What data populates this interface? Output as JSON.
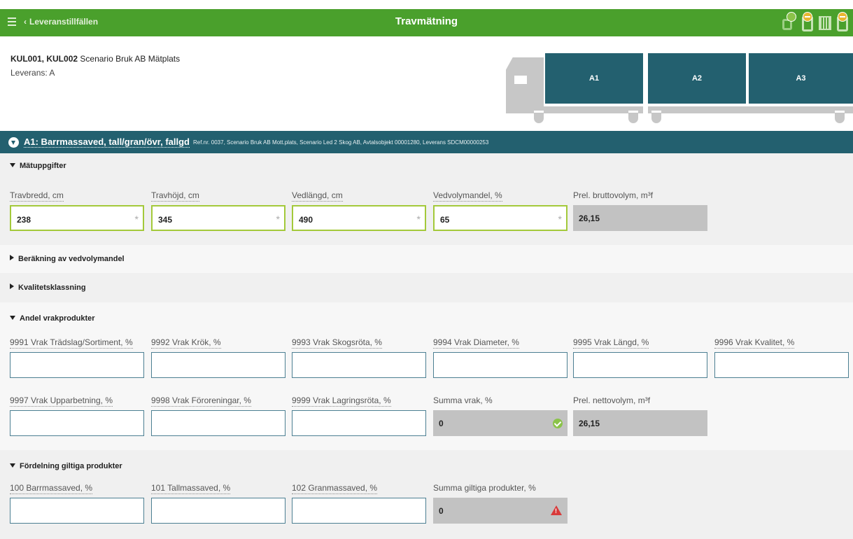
{
  "header": {
    "back_label": "Leveranstillfällen",
    "title": "Travmätning",
    "accent": "#4aa02c"
  },
  "info": {
    "codes": "KUL001, KUL002",
    "place": "Scenario Bruk AB Mätplats",
    "delivery": "Leverans: A"
  },
  "truck": {
    "sections": [
      "A1",
      "A2",
      "A3"
    ],
    "color": "#23606f"
  },
  "item": {
    "title": "A1: Barrmassaved, tall/gran/övr, fallgd",
    "ref": "Ref.nr. 0037, Scenario Bruk AB Mott.plats, Scenario Led 2 Skog AB, Avtalsobjekt 00001280, Leverans SDCM00000253"
  },
  "matuppgifter": {
    "title": "Mätuppgifter",
    "fields": [
      {
        "label": "Travbredd, cm",
        "value": "238"
      },
      {
        "label": "Travhöjd, cm",
        "value": "345"
      },
      {
        "label": "Vedlängd, cm",
        "value": "490"
      },
      {
        "label": "Vedvolymandel, %",
        "value": "65"
      },
      {
        "label": "Prel. bruttovolym, m³f",
        "value": "26,15"
      }
    ],
    "required_mark": "*"
  },
  "collapsed": {
    "ber": "Beräkning av vedvolymandel",
    "kval": "Kvalitetsklassning"
  },
  "vrak": {
    "title": "Andel vrakprodukter",
    "row1": [
      {
        "label": "9991 Vrak Trädslag/Sortiment, %",
        "value": ""
      },
      {
        "label": "9992 Vrak Krök, %",
        "value": ""
      },
      {
        "label": "9993 Vrak Skogsröta, %",
        "value": ""
      },
      {
        "label": "9994 Vrak Diameter, %",
        "value": ""
      },
      {
        "label": "9995 Vrak Längd, %",
        "value": ""
      },
      {
        "label": "9996 Vrak Kvalitet, %",
        "value": ""
      }
    ],
    "row2": [
      {
        "label": "9997 Vrak Upparbetning, %",
        "value": ""
      },
      {
        "label": "9998 Vrak Föroreningar, %",
        "value": ""
      },
      {
        "label": "9999 Vrak Lagringsröta, %",
        "value": ""
      },
      {
        "label": "Summa vrak, %",
        "value": "0"
      },
      {
        "label": "Prel. nettovolym, m³f",
        "value": "26,15"
      }
    ]
  },
  "fordelning": {
    "title": "Fördelning giltiga produkter",
    "fields": [
      {
        "label": "100 Barrmassaved, %",
        "value": ""
      },
      {
        "label": "101 Tallmassaved, %",
        "value": ""
      },
      {
        "label": "102 Granmassaved, %",
        "value": ""
      },
      {
        "label": "Summa giltiga produkter, %",
        "value": "0"
      }
    ]
  }
}
